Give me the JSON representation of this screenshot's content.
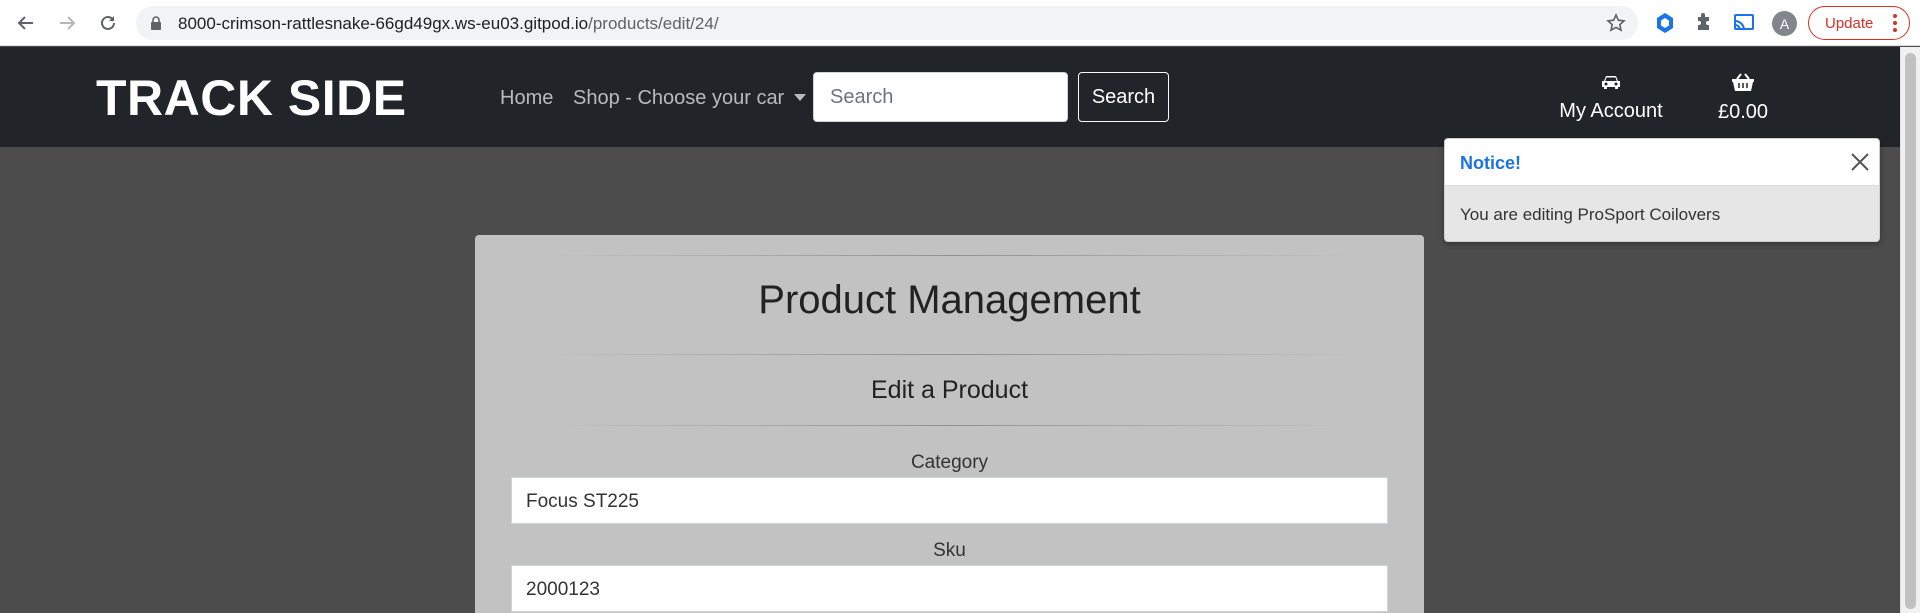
{
  "browser": {
    "url_host": "8000-crimson-rattlesnake-66gd49gx.ws-eu03.gitpod.io",
    "url_path": "/products/edit/24/",
    "profile_initial": "A",
    "update_label": "Update"
  },
  "header": {
    "brand": "TRACK SIDE",
    "nav": {
      "home": "Home",
      "shop": "Shop - Choose your car"
    },
    "search": {
      "placeholder": "Search",
      "button": "Search"
    },
    "account_label": "My Account",
    "basket_total": "£0.00"
  },
  "toast": {
    "title": "Notice!",
    "message": "You are editing ProSport Coilovers"
  },
  "form": {
    "title": "Product Management",
    "subtitle": "Edit a Product",
    "fields": [
      {
        "label": "Category",
        "value": "Focus ST225"
      },
      {
        "label": "Sku",
        "value": "2000123"
      }
    ]
  },
  "colors": {
    "header_bg": "#212529",
    "page_bg": "#4c4c4c",
    "card_bg": "#c2c2c2",
    "toast_title": "#1a73e8"
  },
  "icons": [
    "back-icon",
    "forward-icon",
    "reload-icon",
    "lock-icon",
    "star-icon",
    "extension-icon",
    "puzzle-icon",
    "cast-icon",
    "car-icon",
    "basket-icon",
    "close-icon",
    "more-vert-icon"
  ]
}
